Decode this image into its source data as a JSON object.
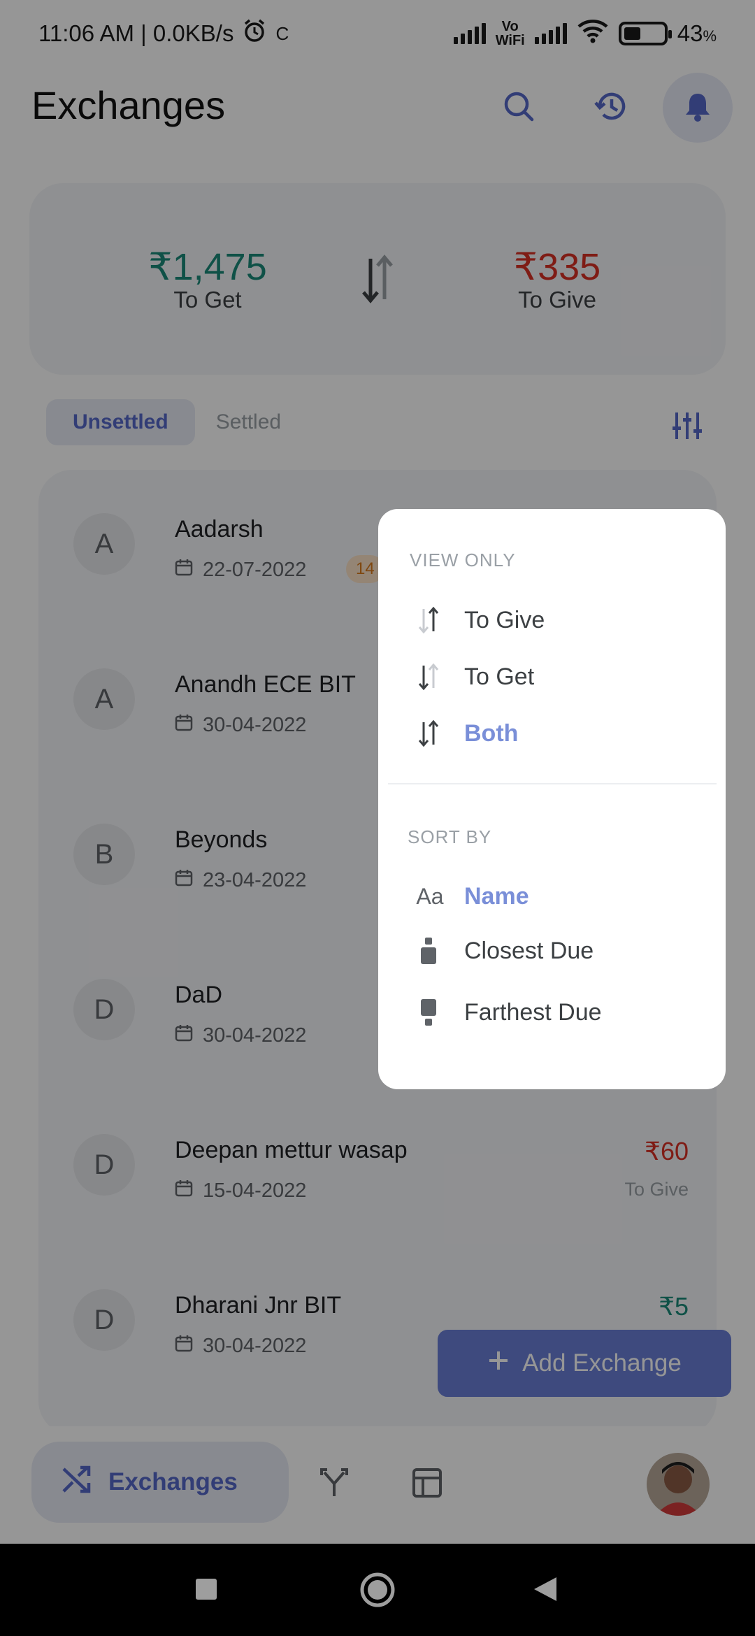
{
  "status_bar": {
    "time": "11:06 AM | 0.0KB/s",
    "extra": "C",
    "vowifi_top": "Vo",
    "vowifi_bottom": "WiFi",
    "battery": "43",
    "battery_unit": "%",
    "battery_level": 0.43
  },
  "header": {
    "title": "Exchanges"
  },
  "summary": {
    "to_get_amount": "₹1,475",
    "to_get_label": "To Get",
    "to_give_amount": "₹335",
    "to_give_label": "To Give"
  },
  "tabs": [
    {
      "label": "Unsettled",
      "active": true
    },
    {
      "label": "Settled",
      "active": false
    }
  ],
  "exchanges": [
    {
      "initial": "A",
      "name": "Aadarsh",
      "date": "22-07-2022",
      "badge": "14",
      "amount": "",
      "type": ""
    },
    {
      "initial": "A",
      "name": "Anandh ECE BIT",
      "date": "30-04-2022",
      "badge": "",
      "amount": "",
      "type": ""
    },
    {
      "initial": "B",
      "name": "Beyonds",
      "date": "23-04-2022",
      "badge": "",
      "amount": "",
      "type": ""
    },
    {
      "initial": "D",
      "name": "DaD",
      "date": "30-04-2022",
      "badge": "",
      "amount": "",
      "type": ""
    },
    {
      "initial": "D",
      "name": "Deepan mettur wasap",
      "date": "15-04-2022",
      "badge": "",
      "amount": "₹60",
      "type": "To Give"
    },
    {
      "initial": "D",
      "name": "Dharani Jnr BIT",
      "date": "30-04-2022",
      "badge": "",
      "amount": "₹5",
      "type": ""
    }
  ],
  "fab": {
    "label": "Add Exchange"
  },
  "bottom_nav": {
    "active_label": "Exchanges"
  },
  "popup": {
    "view_only_title": "VIEW ONLY",
    "view_options": [
      {
        "label": "To Give",
        "selected": false
      },
      {
        "label": "To Get",
        "selected": false
      },
      {
        "label": "Both",
        "selected": true
      }
    ],
    "sort_by_title": "SORT BY",
    "sort_options": [
      {
        "icon_text": "Aa",
        "label": "Name",
        "selected": true
      },
      {
        "icon_text": "",
        "label": "Closest Due",
        "selected": false
      },
      {
        "icon_text": "",
        "label": "Farthest Due",
        "selected": false
      }
    ]
  },
  "colors": {
    "accent": "#5568c9",
    "get": "#1a8a7a",
    "give": "#d93025",
    "selected_option": "#7a8fd8"
  }
}
